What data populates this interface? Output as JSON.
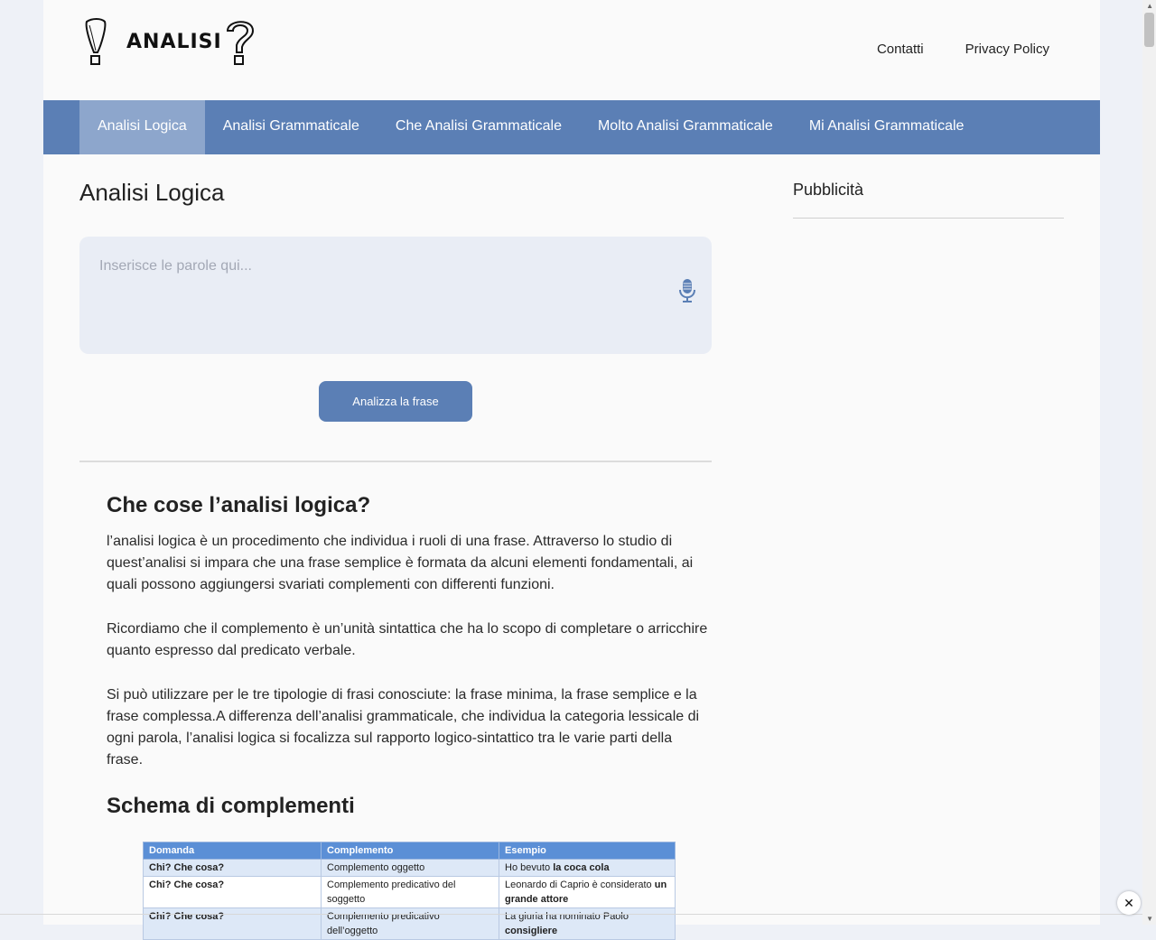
{
  "header": {
    "logo_word": "ANALISI",
    "links": [
      "Contatti",
      "Privacy Policy"
    ]
  },
  "nav": {
    "items": [
      "Analisi Logica",
      "Analisi Grammaticale",
      "Che Analisi Grammaticale",
      "Molto Analisi Grammaticale",
      "Mi Analisi Grammaticale"
    ],
    "active_index": 0
  },
  "main": {
    "title": "Analisi Logica",
    "input_placeholder": "Inserisce le parole qui...",
    "button_label": "Analizza la frase"
  },
  "article": {
    "heading1": "Che cose l’analisi logica?",
    "p1": " l’analisi logica è un procedimento che individua i ruoli di una frase. Attraverso lo studio di quest’analisi si impara che una frase semplice è formata da alcuni elementi fondamentali, ai quali possono aggiungersi svariati complementi con differenti funzioni.",
    "p2": "Ricordiamo che il complemento è un’unità sintattica che ha lo scopo di completare o arricchire quanto espresso dal predicato verbale.",
    "p3": "Si può utilizzare per le tre tipologie di frasi conosciute: la frase minima, la frase semplice e la frase complessa.A differenza dell’analisi grammaticale, che individua la categoria lessicale di ogni parola, l’analisi logica si focalizza sul rapporto logico-sintattico tra le varie parti della frase.",
    "heading2": "Schema di complementi"
  },
  "table": {
    "headers": [
      "Domanda",
      "Complemento",
      "Esempio"
    ],
    "rows": [
      {
        "q": "Chi? Che cosa?",
        "c": "Complemento oggetto",
        "e_plain": "Ho bevuto ",
        "e_bold": "la coca cola"
      },
      {
        "q": "Chi? Che cosa?",
        "c": "Complemento predicativo del soggetto",
        "e_plain": "Leonardo di Caprio è considerato ",
        "e_bold": "un grande attore"
      },
      {
        "q": "Chi? Che cosa?",
        "c": "Complemento predicativo dell’oggetto",
        "e_plain": "La giuria ha nominato Paolo ",
        "e_bold": "consigliere"
      }
    ]
  },
  "sidebar": {
    "title": "Pubblicità"
  },
  "overlay": {
    "close_label": "✕"
  },
  "colors": {
    "accent": "#5b7fb5",
    "nav_active": "#8da6cc",
    "page_bg": "#eef1f7"
  }
}
